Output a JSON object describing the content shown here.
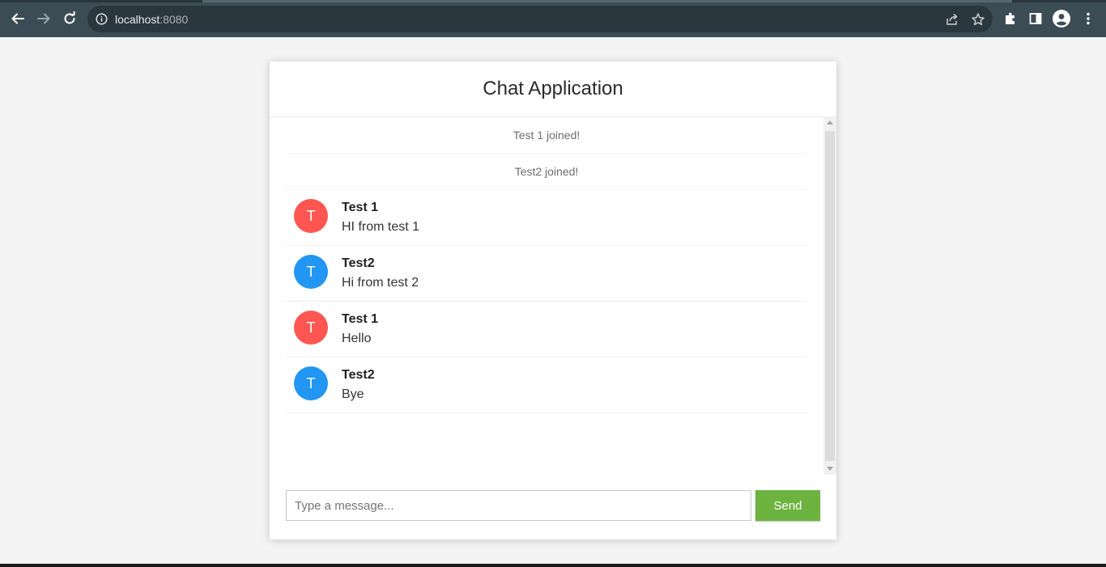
{
  "browser": {
    "url_host": "localhost",
    "url_port": ":8080"
  },
  "app": {
    "title": "Chat Application"
  },
  "messages": [
    {
      "kind": "event",
      "text": "Test 1 joined!"
    },
    {
      "kind": "event",
      "text": "Test2 joined!"
    },
    {
      "kind": "chat",
      "initial": "T",
      "sender": "Test 1",
      "text": "HI from test 1",
      "color": "#ff5652"
    },
    {
      "kind": "chat",
      "initial": "T",
      "sender": "Test2",
      "text": "Hi from test 2",
      "color": "#2196f3"
    },
    {
      "kind": "chat",
      "initial": "T",
      "sender": "Test 1",
      "text": "Hello",
      "color": "#ff5652"
    },
    {
      "kind": "chat",
      "initial": "T",
      "sender": "Test2",
      "text": "Bye",
      "color": "#2196f3"
    }
  ],
  "composer": {
    "placeholder": "Type a message...",
    "value": "",
    "send_label": "Send",
    "send_color": "#6db33f"
  },
  "icons": {
    "back": "arrow-left-icon",
    "forward": "arrow-right-icon",
    "reload": "reload-icon",
    "site_info": "info-icon",
    "share": "share-icon",
    "bookmark": "star-icon",
    "extensions": "puzzle-icon",
    "side_panel": "side-panel-icon",
    "profile": "profile-icon",
    "menu": "kebab-menu-icon"
  }
}
